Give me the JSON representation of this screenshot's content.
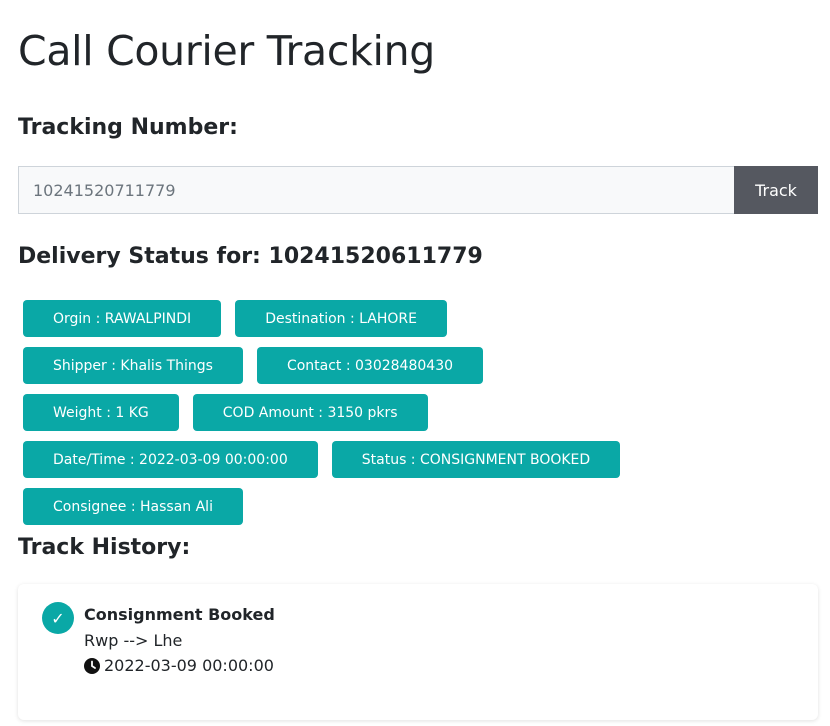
{
  "page": {
    "title": "Call Courier Tracking"
  },
  "search": {
    "label": "Tracking Number:",
    "value": "10241520711779",
    "button_label": "Track"
  },
  "delivery": {
    "heading": "Delivery Status for: 10241520611779",
    "badges": [
      {
        "text": "Orgin : RAWALPINDI"
      },
      {
        "text": "Destination : LAHORE"
      },
      {
        "text": "Shipper : Khalis Things"
      },
      {
        "text": "Contact : 03028480430"
      },
      {
        "text": "Weight : 1 KG"
      },
      {
        "text": "COD Amount : 3150 pkrs"
      },
      {
        "text": "Date/Time : 2022-03-09 00:00:00"
      },
      {
        "text": "Status : CONSIGNMENT BOOKED"
      },
      {
        "text": "Consignee : Hassan Ali"
      }
    ]
  },
  "history": {
    "heading": "Track History:",
    "events": [
      {
        "icon": "check-icon",
        "title": "Consignment Booked",
        "route": "Rwp --> Lhe",
        "time_icon": "clock-icon",
        "datetime": "2022-03-09 00:00:00"
      }
    ]
  },
  "colors": {
    "accent": "#0aa8a6",
    "button": "#555860",
    "text": "#212529"
  }
}
